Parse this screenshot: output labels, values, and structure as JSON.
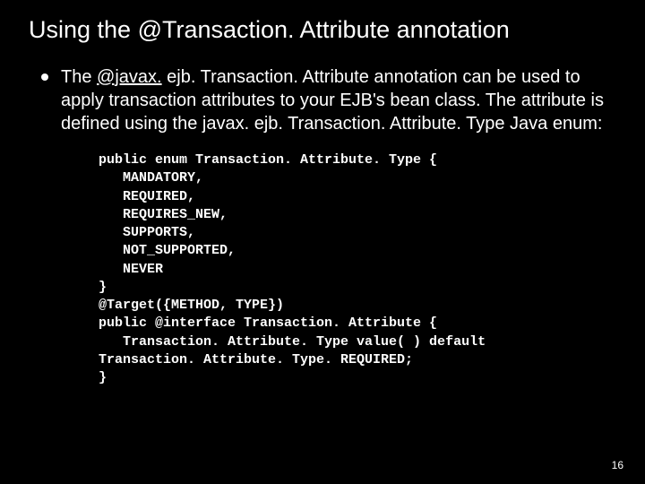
{
  "slide": {
    "title": "Using the @Transaction. Attribute annotation",
    "bullet_prefix": "The ",
    "bullet_underlined": "@javax.",
    "bullet_rest": " ejb. Transaction. Attribute annotation can be used to apply transaction attributes to your EJB's bean class. The attribute is defined using the javax. ejb. Transaction. Attribute. Type Java enum:",
    "code": "public enum Transaction. Attribute. Type {\n   MANDATORY,\n   REQUIRED,\n   REQUIRES_NEW,\n   SUPPORTS,\n   NOT_SUPPORTED,\n   NEVER\n}\n@Target({METHOD, TYPE})\npublic @interface Transaction. Attribute {\n   Transaction. Attribute. Type value( ) default\nTransaction. Attribute. Type. REQUIRED;\n}",
    "page_number": "16"
  }
}
